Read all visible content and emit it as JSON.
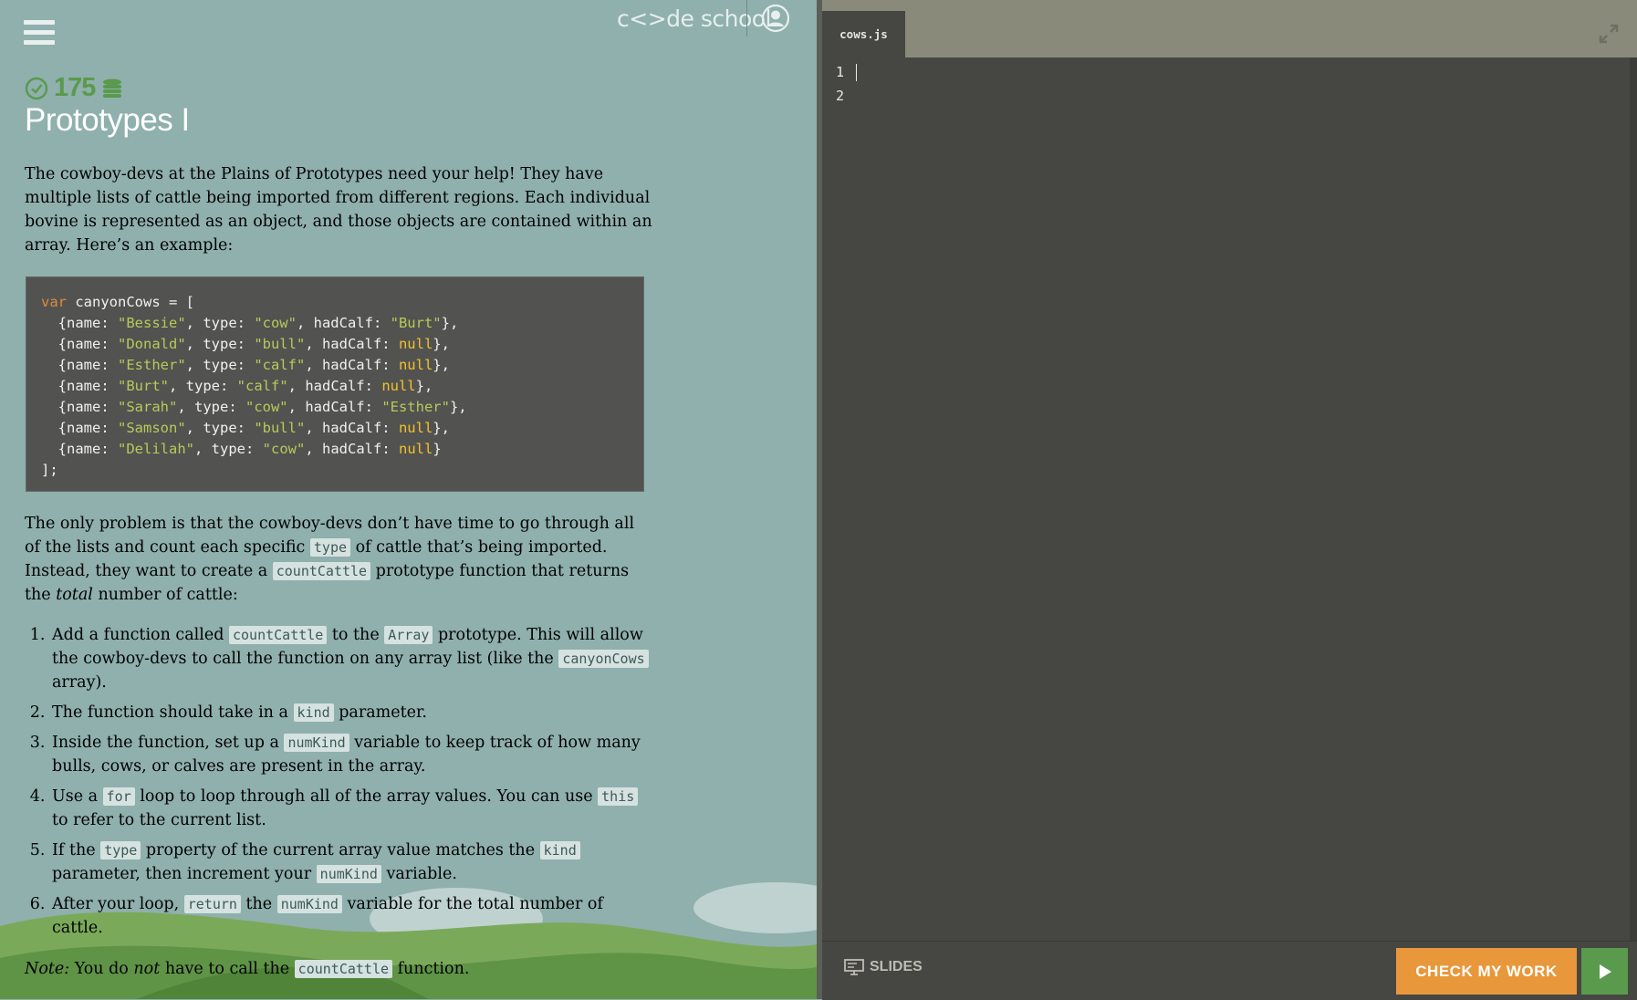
{
  "header": {
    "brand": "c<>de school",
    "points": "175"
  },
  "lesson": {
    "title": "Prototypes I",
    "intro": "The cowboy-devs at the Plains of Prototypes need your help! They have multiple lists of cattle being imported from different regions. Each individual bovine is represented as an object, and those objects are contained within an array. Here’s an example:",
    "code_sample": {
      "decl_keyword": "var",
      "decl_rest": " canyonCows = [",
      "rows": [
        {
          "name": "\"Bessie\"",
          "type": "\"cow\"",
          "hadCalf": "\"Burt\"",
          "calf_is_null": false
        },
        {
          "name": "\"Donald\"",
          "type": "\"bull\"",
          "hadCalf": "null",
          "calf_is_null": true
        },
        {
          "name": "\"Esther\"",
          "type": "\"calf\"",
          "hadCalf": "null",
          "calf_is_null": true
        },
        {
          "name": "\"Burt\"",
          "type": "\"calf\"",
          "hadCalf": "null",
          "calf_is_null": true
        },
        {
          "name": "\"Sarah\"",
          "type": "\"cow\"",
          "hadCalf": "\"Esther\"",
          "calf_is_null": false
        },
        {
          "name": "\"Samson\"",
          "type": "\"bull\"",
          "hadCalf": "null",
          "calf_is_null": true
        },
        {
          "name": "\"Delilah\"",
          "type": "\"cow\"",
          "hadCalf": "null",
          "calf_is_null": true
        }
      ],
      "closing": "];"
    },
    "para2": {
      "t1": "The only problem is that the cowboy-devs don’t have time to go through all of the lists and count each specific ",
      "c1": "type",
      "t2": " of cattle that’s being imported. Instead, they want to create a ",
      "c2": "countCattle",
      "t3": " prototype function that returns the ",
      "em": "total",
      "t4": " number of cattle:"
    },
    "steps": [
      {
        "parts": [
          [
            "t",
            "Add a function called "
          ],
          [
            "c",
            "countCattle"
          ],
          [
            "t",
            " to the "
          ],
          [
            "c",
            "Array"
          ],
          [
            "t",
            " prototype. This will allow the cowboy-devs to call the function on any array list (like the "
          ],
          [
            "c",
            "canyonCows"
          ],
          [
            "t",
            " array)."
          ]
        ]
      },
      {
        "parts": [
          [
            "t",
            "The function should take in a "
          ],
          [
            "c",
            "kind"
          ],
          [
            "t",
            " parameter."
          ]
        ]
      },
      {
        "parts": [
          [
            "t",
            "Inside the function, set up a "
          ],
          [
            "c",
            "numKind"
          ],
          [
            "t",
            " variable to keep track of how many bulls, cows, or calves are present in the array."
          ]
        ]
      },
      {
        "parts": [
          [
            "t",
            "Use a "
          ],
          [
            "c",
            "for"
          ],
          [
            "t",
            " loop to loop through all of the array values. You can use "
          ],
          [
            "c",
            "this"
          ],
          [
            "t",
            " to refer to the current list."
          ]
        ]
      },
      {
        "parts": [
          [
            "t",
            "If the "
          ],
          [
            "c",
            "type"
          ],
          [
            "t",
            " property of the current array value matches the "
          ],
          [
            "c",
            "kind"
          ],
          [
            "t",
            " parameter, then increment your "
          ],
          [
            "c",
            "numKind"
          ],
          [
            "t",
            " variable."
          ]
        ]
      },
      {
        "parts": [
          [
            "t",
            "After your loop, "
          ],
          [
            "c",
            "return"
          ],
          [
            "t",
            " the "
          ],
          [
            "c",
            "numKind"
          ],
          [
            "t",
            " variable for the total number of cattle."
          ]
        ]
      }
    ],
    "note": {
      "label": "Note:",
      "t1": " You do ",
      "em": "not",
      "t2": " have to call the ",
      "c": "countCattle",
      "t3": " function."
    }
  },
  "editor": {
    "tab_label": "cows.js",
    "line_numbers": [
      "1",
      "2"
    ],
    "content": ""
  },
  "footer": {
    "slides_label": "SLIDES",
    "check_label": "CHECK MY WORK"
  },
  "colors": {
    "left_bg": "#8fb0ad",
    "editor_bg": "#464642",
    "accent_orange": "#e8973b",
    "accent_green": "#5a9a4d"
  },
  "icons": [
    "menu-icon",
    "profile-icon",
    "check-circle-icon",
    "coins-icon",
    "expand-icon",
    "slides-icon",
    "play-icon"
  ]
}
